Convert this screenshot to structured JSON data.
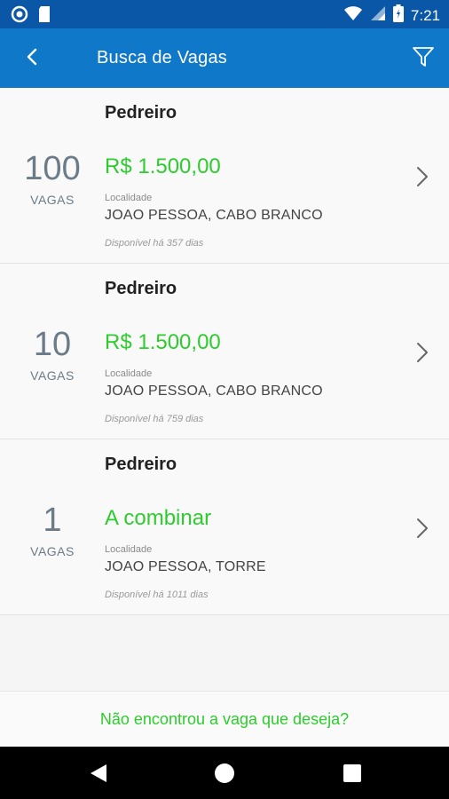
{
  "status_bar": {
    "time": "7:21"
  },
  "header": {
    "title": "Busca de Vagas"
  },
  "jobs": [
    {
      "title": "Pedreiro",
      "count": "100",
      "count_label": "VAGAS",
      "salary": "R$ 1.500,00",
      "location_label": "Localidade",
      "location": "JOAO PESSOA, CABO BRANCO",
      "available": "Disponível há 357 dias"
    },
    {
      "title": "Pedreiro",
      "count": "10",
      "count_label": "VAGAS",
      "salary": "R$ 1.500,00",
      "location_label": "Localidade",
      "location": "JOAO PESSOA, CABO BRANCO",
      "available": "Disponível há 759 dias"
    },
    {
      "title": "Pedreiro",
      "count": "1",
      "count_label": "VAGAS",
      "salary": "A combinar",
      "location_label": "Localidade",
      "location": "JOAO PESSOA, TORRE",
      "available": "Disponível há 1011 dias"
    }
  ],
  "footer": {
    "link": "Não encontrou a vaga que deseja?"
  },
  "icons": {
    "back": "arrow-back-icon",
    "filter": "filter-icon",
    "chevron": "chevron-right-icon",
    "nav_back": "nav-back-icon",
    "nav_home": "nav-home-icon",
    "nav_recents": "nav-recents-icon"
  },
  "colors": {
    "primary": "#1078c9",
    "status_bar": "#0a57a8",
    "accent_green": "#2ecc2e",
    "count_gray": "#6b7b88"
  }
}
